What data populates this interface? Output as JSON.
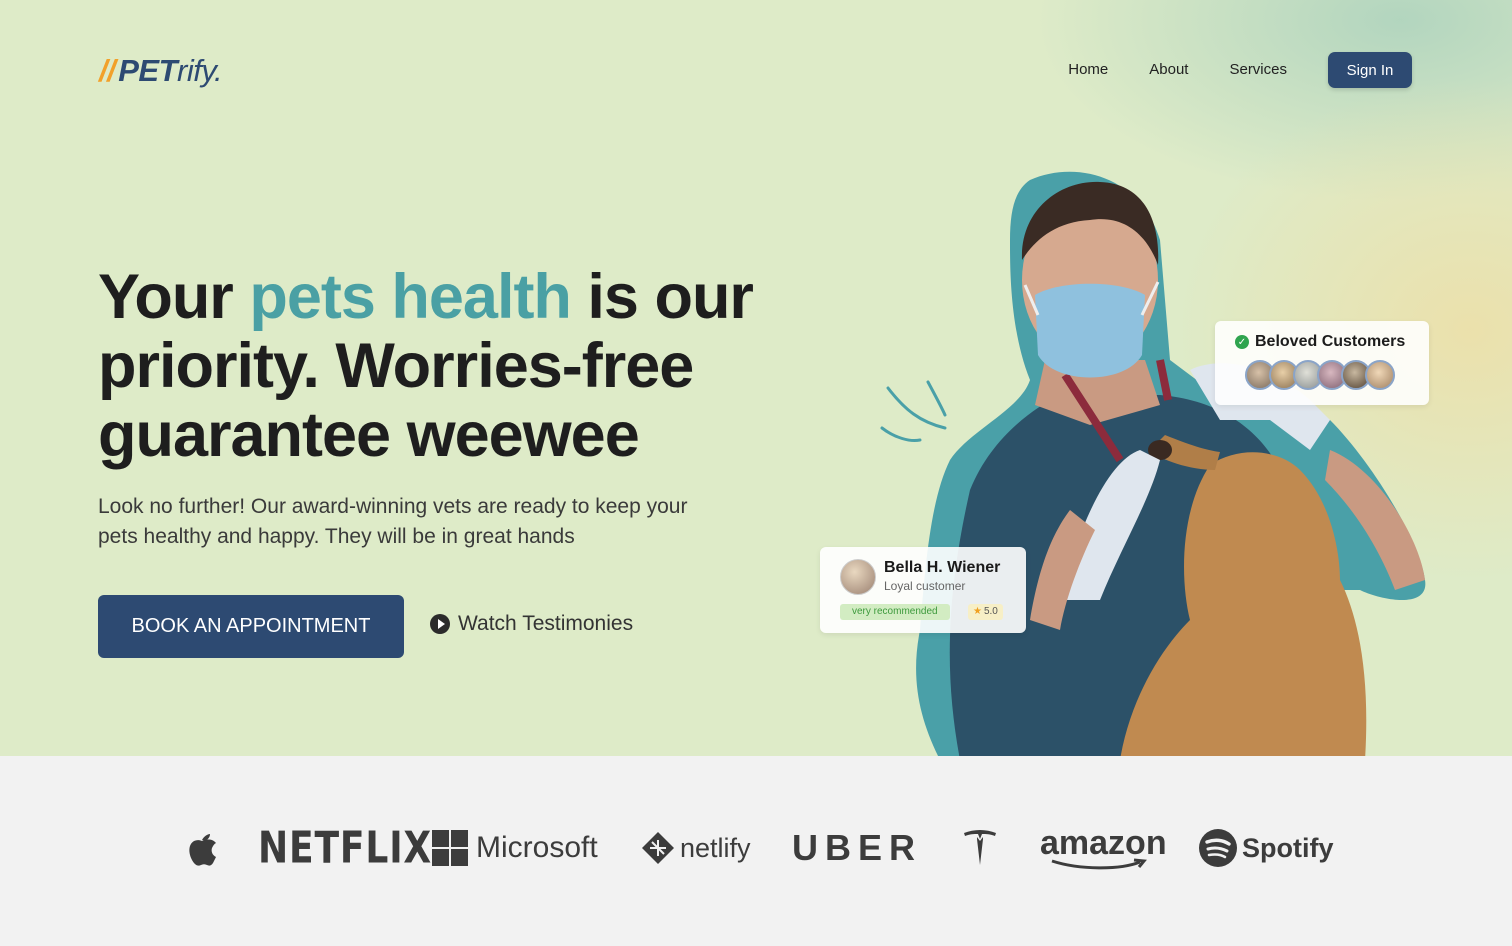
{
  "header": {
    "logo": {
      "slash": "//",
      "bold": "PET",
      "light": "rify."
    },
    "nav": [
      {
        "label": "Home"
      },
      {
        "label": "About"
      },
      {
        "label": "Services"
      }
    ],
    "signin_label": "Sign In"
  },
  "hero": {
    "headline_start": "Your ",
    "headline_accent": "pets health",
    "headline_rest": " is our priority. Worries-free guarantee weewee",
    "subtext": "Look no further! Our award-winning vets are ready to keep your pets healthy and happy. They will be in great hands",
    "cta_label": "BOOK AN APPOINTMENT",
    "watch_label": "Watch Testimonies"
  },
  "beloved": {
    "title": "Beloved Customers",
    "avatar_count": 6
  },
  "review": {
    "name": "Bella H. Wiener",
    "role": "Loyal customer",
    "tag": "very recommended",
    "rating": "5.0"
  },
  "logos": [
    {
      "name": "apple-logo"
    },
    {
      "name": "NETFLIX"
    },
    {
      "name": "Microsoft"
    },
    {
      "name": "netlify"
    },
    {
      "name": "UBER"
    },
    {
      "name": "tesla-logo"
    },
    {
      "name": "amazon"
    },
    {
      "name": "Spotify"
    }
  ],
  "colors": {
    "primary": "#2d4a72",
    "accent": "#4aa0a4",
    "logo_slash": "#f2a12a",
    "hero_bg": "#deebc8",
    "logos_bg": "#f2f2f2"
  }
}
